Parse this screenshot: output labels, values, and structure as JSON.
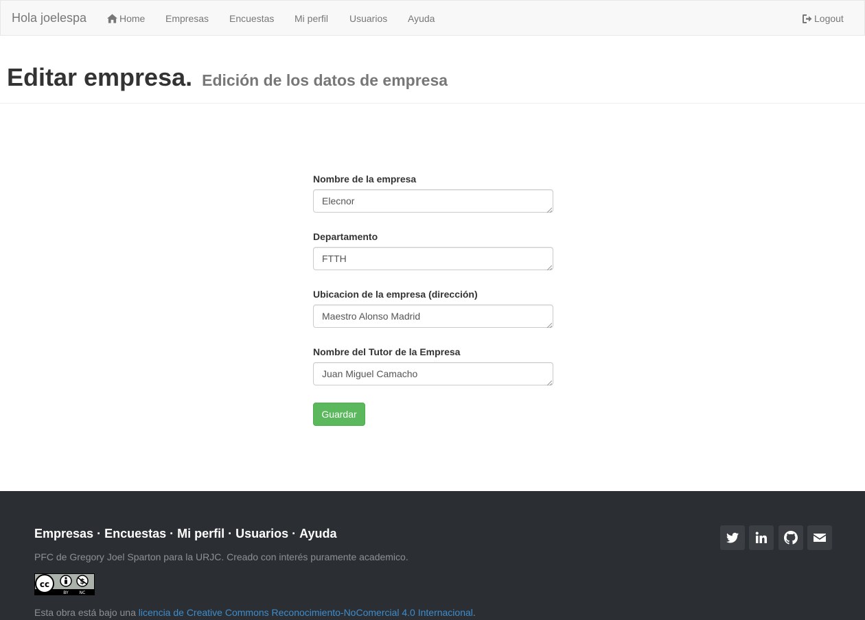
{
  "navbar": {
    "brand": "Hola joelespa",
    "items": [
      {
        "label": "Home",
        "icon": "home-icon"
      },
      {
        "label": "Empresas"
      },
      {
        "label": "Encuestas"
      },
      {
        "label": "Mi perfil"
      },
      {
        "label": "Usuarios"
      },
      {
        "label": "Ayuda"
      }
    ],
    "logout": {
      "label": "Logout",
      "icon": "logout-icon"
    }
  },
  "header": {
    "title": "Editar empresa.",
    "subtitle": "Edición de los datos de empresa"
  },
  "form": {
    "fields": [
      {
        "label": "Nombre de la empresa",
        "value": "Elecnor"
      },
      {
        "label": "Departamento",
        "value": "FTTH"
      },
      {
        "label": "Ubicacion de la empresa (dirección)",
        "value": "Maestro Alonso Madrid"
      },
      {
        "label": "Nombre del Tutor de la Empresa",
        "value": "Juan Miguel Camacho"
      }
    ],
    "submit_label": "Guardar"
  },
  "footer": {
    "links": [
      "Empresas",
      "Encuestas",
      "Mi perfil",
      "Usuarios",
      "Ayuda"
    ],
    "separator": "·",
    "credit": "PFC de Gregory Joel Sparton para la URJC. Creado con interés puramente academico.",
    "license_prefix": "Esta obra está bajo una ",
    "license_link": "licencia de Creative Commons Reconocimiento-NoComercial 4.0 Internacional",
    "license_suffix": ".",
    "social_icons": [
      "twitter-icon",
      "linkedin-icon",
      "github-icon",
      "envelope-icon"
    ],
    "badge_labels": {
      "cc": "cc",
      "by": "BY",
      "nc": "NC"
    }
  },
  "colors": {
    "navbar_bg": "#f8f8f8",
    "footer_bg": "#2b2f33",
    "button_green": "#5cb85c",
    "link_blue": "#3f8ccc"
  }
}
